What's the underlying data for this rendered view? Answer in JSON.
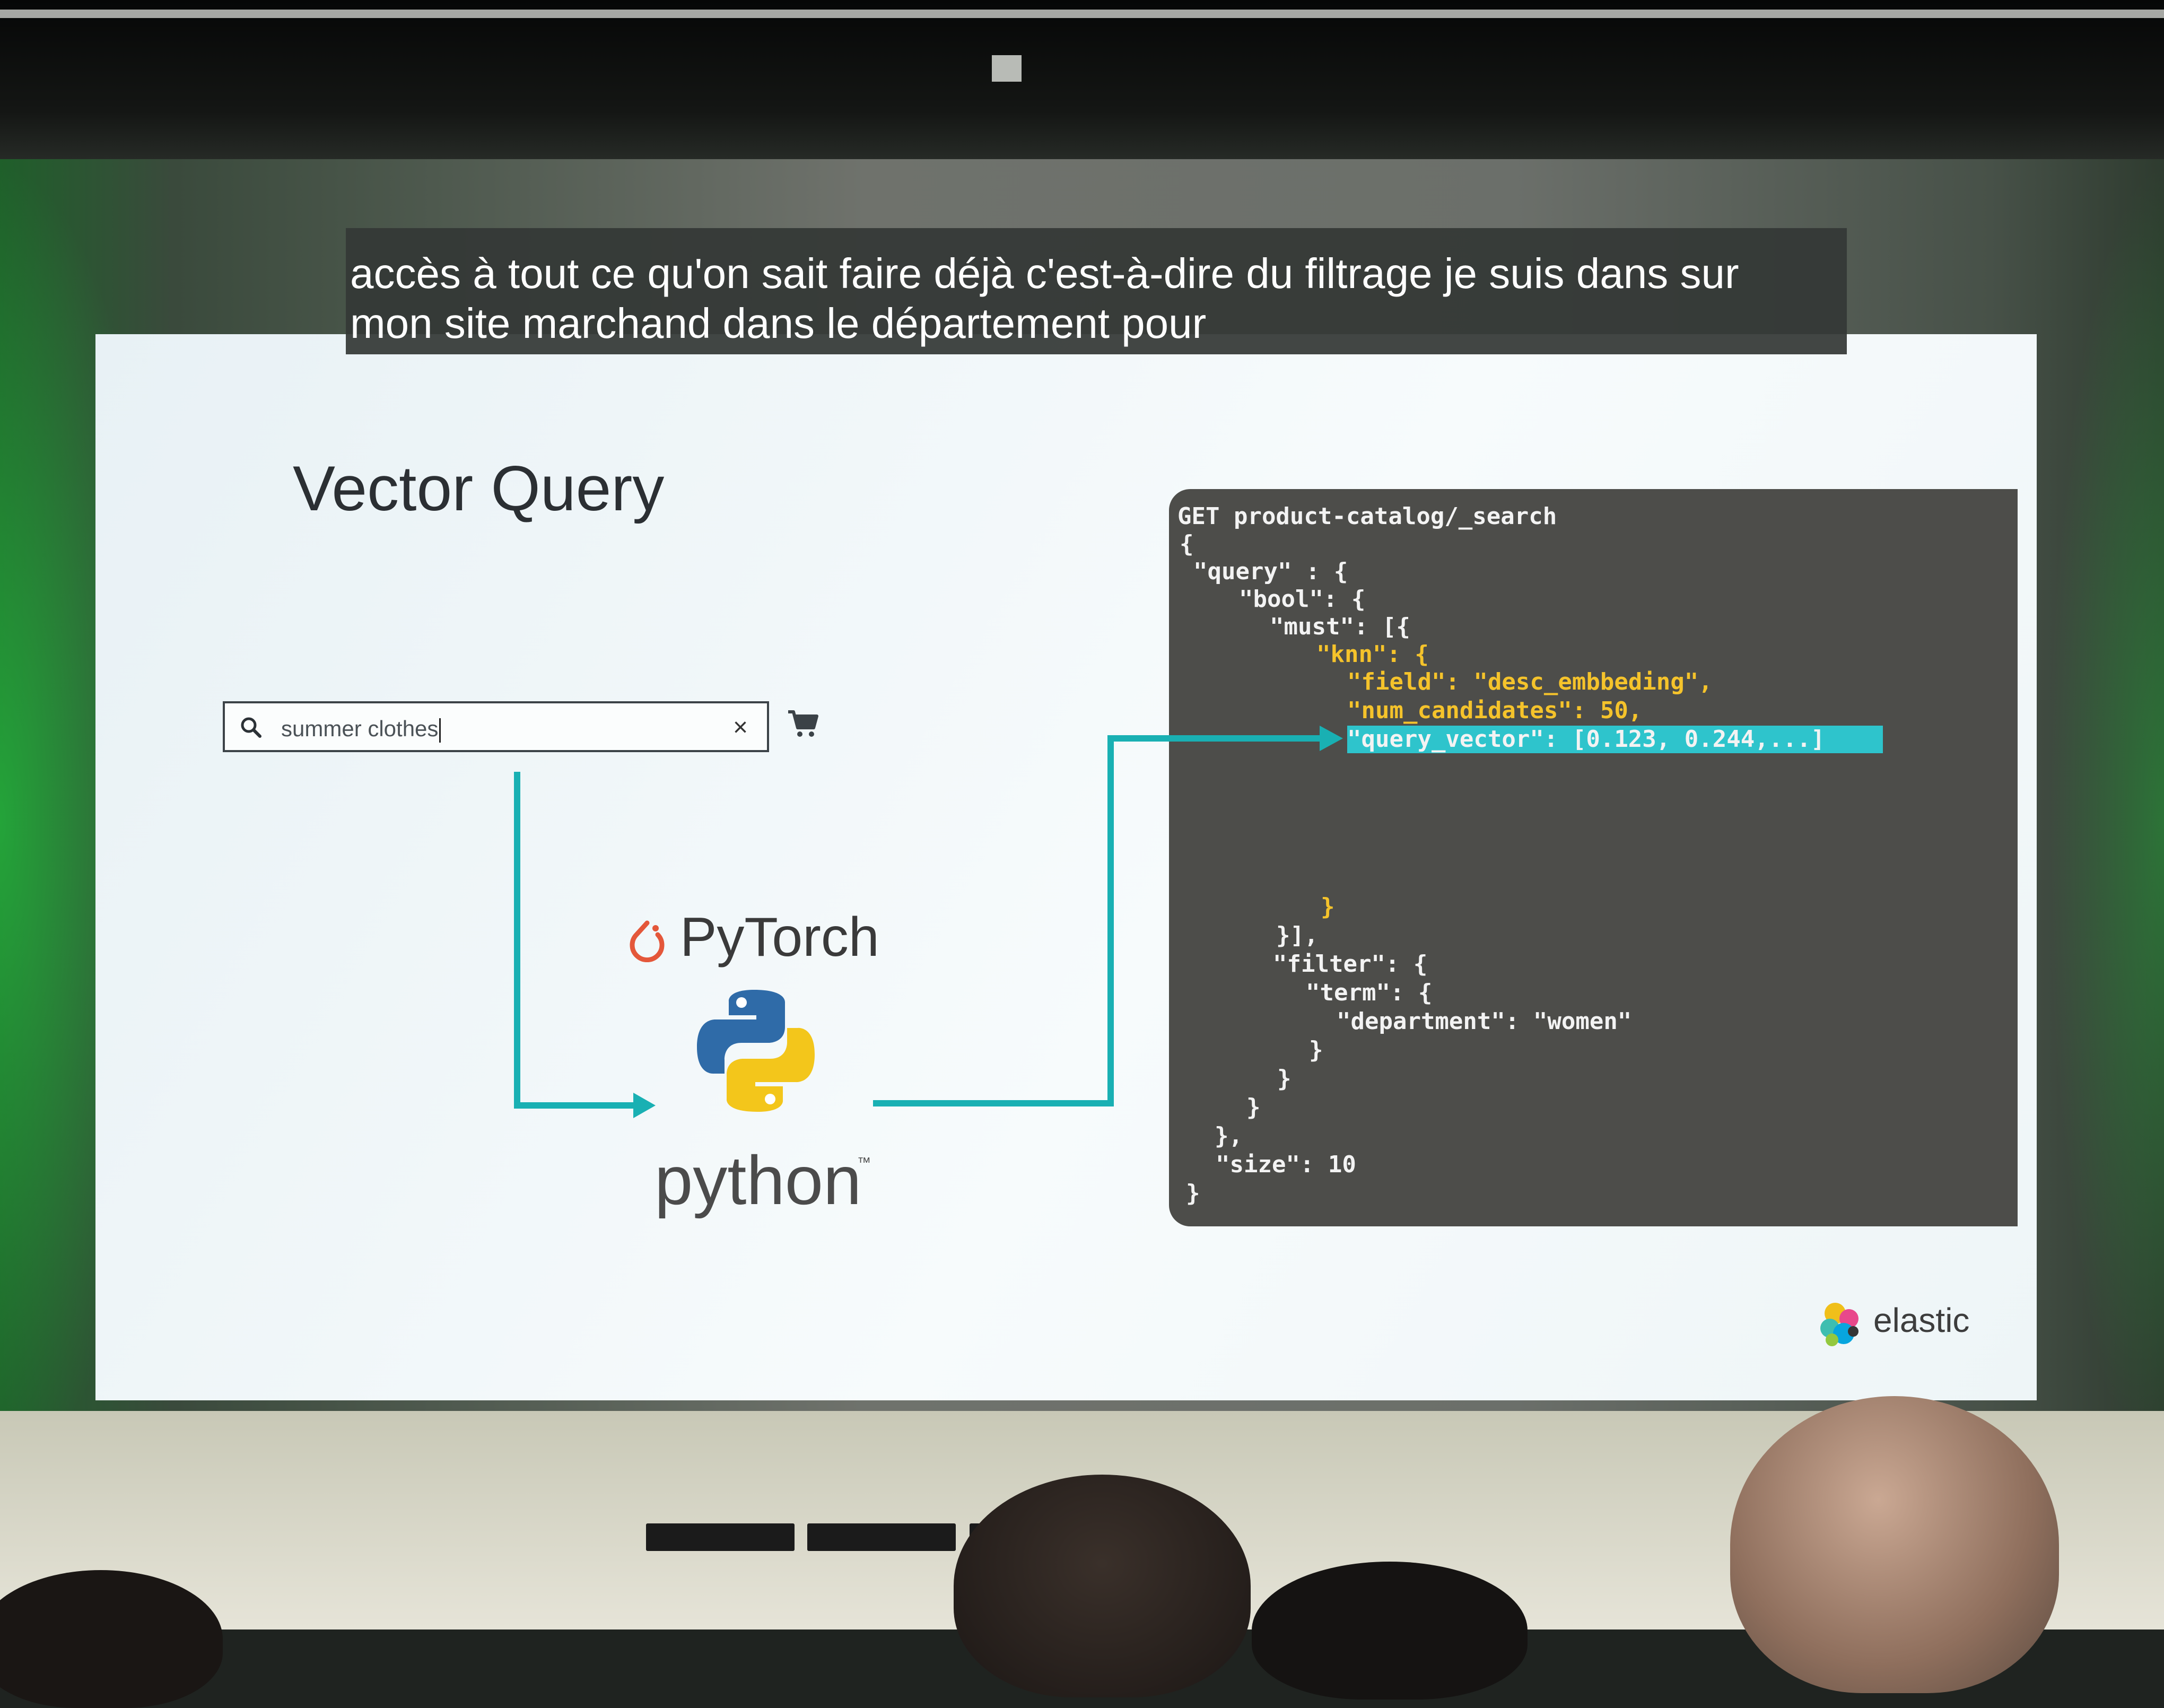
{
  "caption": {
    "line1": "accès à tout ce qu'on sait faire déjà c'est-à-dire du filtrage je suis dans sur",
    "line2": "mon site marchand dans le département pour"
  },
  "slide": {
    "title": "Vector Query",
    "search": {
      "value": "summer clothes",
      "clear_symbol": "×"
    },
    "pytorch_label": "PyTorch",
    "python_label": "python",
    "python_tm": "™",
    "brand": "elastic",
    "colors": {
      "arrow": "#19b0b3",
      "code_bg": "#4d4d4a",
      "highlight": "#2ec4cc",
      "key_yellow": "#f5c32b"
    }
  },
  "code": {
    "l1": "GET product-catalog/_search",
    "l2": "{",
    "l3": "\"query\" : {",
    "l4": "\"bool\": {",
    "l5": "\"must\": [{",
    "l6": "\"knn\": {",
    "l7": "\"field\": \"desc_embbeding\",",
    "l8": "\"num_candidates\": 50,",
    "l9": "\"query_vector\": [0.123, 0.244,...]",
    "l10": "}",
    "l11": "}],",
    "l12": "\"filter\": {",
    "l13": "\"term\": {",
    "l14": "\"department\": \"women\"",
    "l15": "}",
    "l16": "}",
    "l17": "}",
    "l18": "},",
    "l19": "\"size\": 10",
    "l20": "}"
  }
}
